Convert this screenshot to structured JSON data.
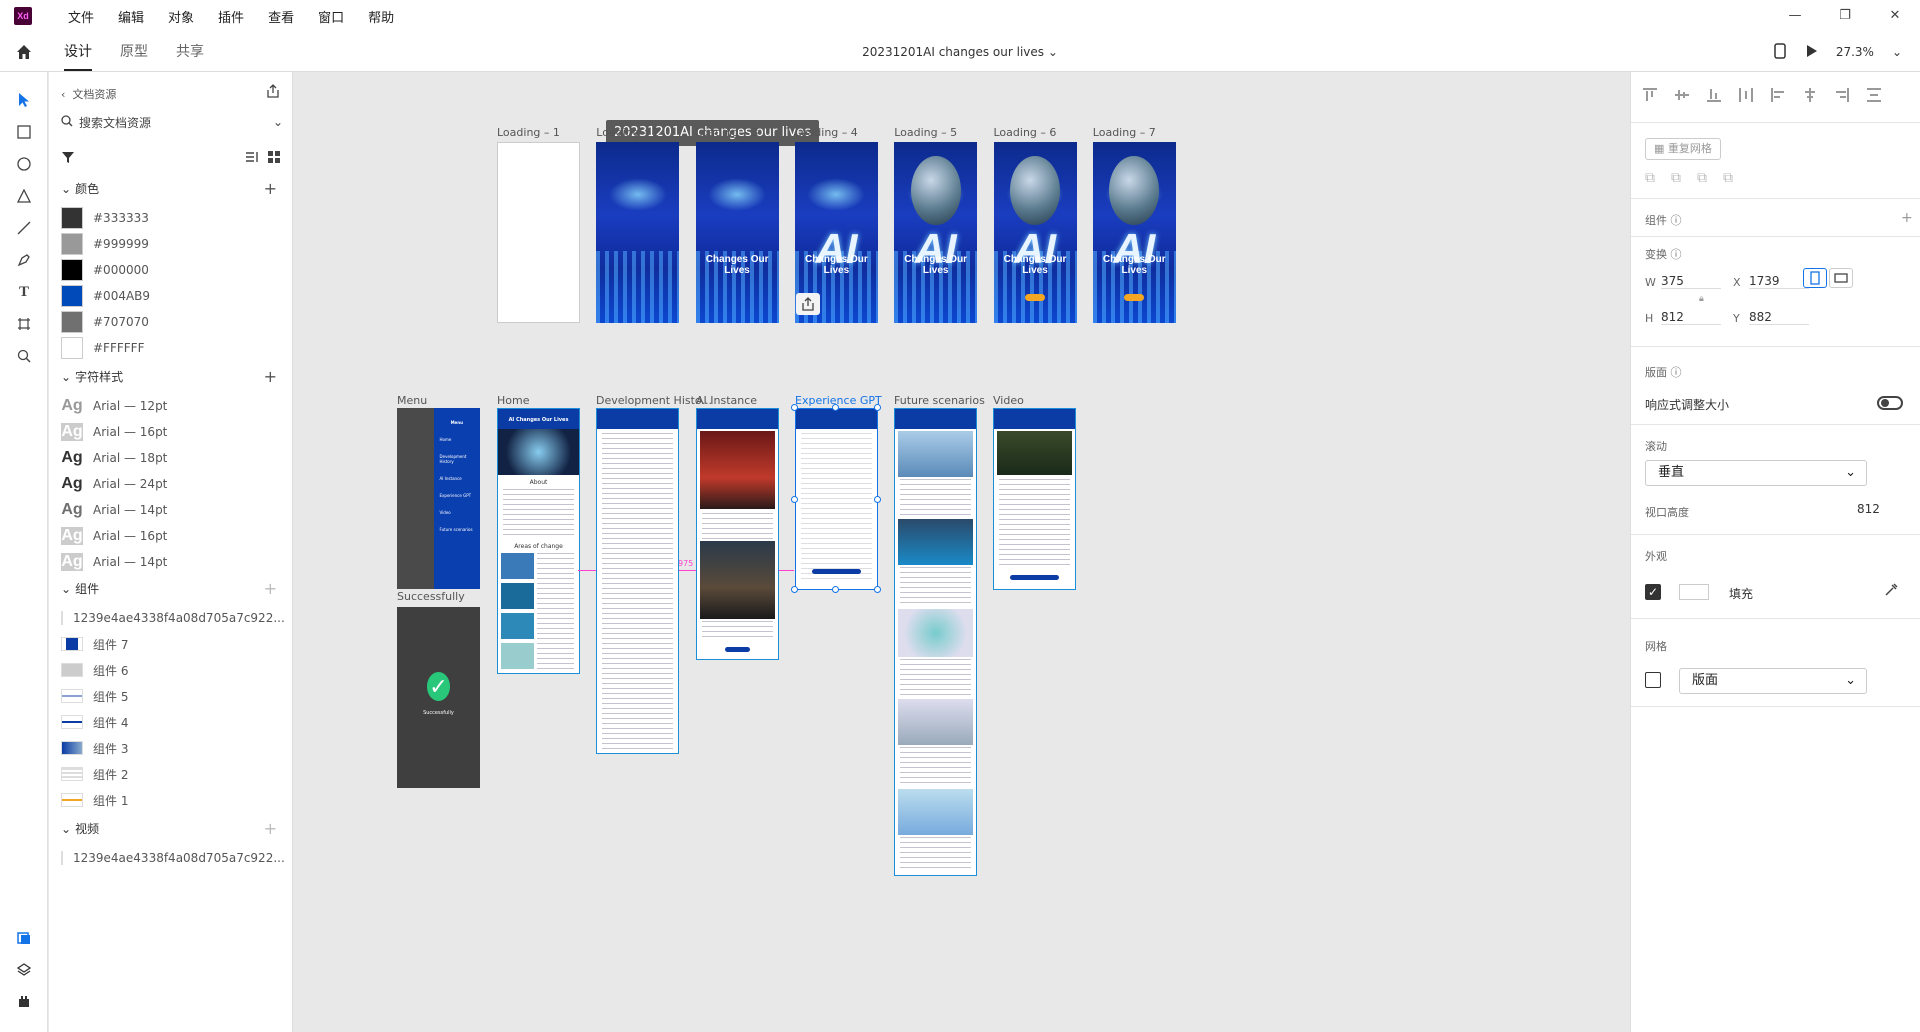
{
  "app": {
    "logo": "Xd",
    "accent": "#1473e6",
    "brand_color": "#470137"
  },
  "menu": [
    "文件",
    "编辑",
    "对象",
    "插件",
    "查看",
    "窗口",
    "帮助"
  ],
  "tabs": [
    "设计",
    "原型",
    "共享"
  ],
  "active_tab": "设计",
  "document_title": "20231201AI changes our lives",
  "zoom": "27.3%",
  "assets": {
    "header": "文档资源",
    "search_placeholder": "搜索文档资源",
    "colors_title": "颜色",
    "colors": [
      {
        "hex": "#333333",
        "label": "#333333"
      },
      {
        "hex": "#999999",
        "label": "#999999"
      },
      {
        "hex": "#000000",
        "label": "#000000"
      },
      {
        "hex": "#004AB9",
        "label": "#004AB9"
      },
      {
        "hex": "#707070",
        "label": "#707070"
      },
      {
        "hex": "#FFFFFF",
        "label": "#FFFFFF"
      }
    ],
    "char_title": "字符样式",
    "char_styles": [
      {
        "sample": "Ag",
        "label": "Arial — 12pt",
        "color": "#999999",
        "bg": "#ffffff"
      },
      {
        "sample": "Ag",
        "label": "Arial — 16pt",
        "color": "#ffffff",
        "bg": "#cccccc"
      },
      {
        "sample": "Ag",
        "label": "Arial — 18pt",
        "color": "#333333",
        "bg": "#ffffff"
      },
      {
        "sample": "Ag",
        "label": "Arial — 24pt",
        "color": "#333333",
        "bg": "#ffffff"
      },
      {
        "sample": "Ag",
        "label": "Arial — 14pt",
        "color": "#707070",
        "bg": "#ffffff"
      },
      {
        "sample": "Ag",
        "label": "Arial — 16pt",
        "color": "#ffffff",
        "bg": "#cccccc"
      },
      {
        "sample": "Ag",
        "label": "Arial — 14pt",
        "color": "#ffffff",
        "bg": "#cccccc"
      }
    ],
    "components_title": "组件",
    "components": [
      "1239e4ae4338f4a08d705a7c922...",
      "组件 7",
      "组件 6",
      "组件 5",
      "组件 4",
      "组件 3",
      "组件 2",
      "组件 1"
    ],
    "video_title": "视频",
    "videos": [
      "1239e4ae4338f4a08d705a7c922..."
    ]
  },
  "canvas": {
    "doc_chip": "20231201AI changes our lives",
    "loading_labels": [
      "Loading – 1",
      "Loading – 2",
      "Loading – 3",
      "Loading – 4",
      "Loading – 5",
      "Loading – 6",
      "Loading – 7"
    ],
    "loading_ai_text": "AI",
    "loading_subtitle": "Changes Our Lives",
    "page_labels": [
      "Menu",
      "Home",
      "Development Histo...",
      "AI Instance",
      "Experience GPT",
      "Future scenarios",
      "Video"
    ],
    "successfully_label": "Successfully",
    "success_text": "Successfully",
    "guide_value": "975",
    "home_title": "AI Changes Our Lives",
    "home_about": "About",
    "home_areas": "Areas of change",
    "menu_items": [
      "Menu",
      "Home",
      "Development History",
      "AI Instance",
      "Experience GPT",
      "Video",
      "Future scenarios"
    ]
  },
  "props": {
    "repeat_grid": "重复网格",
    "component_label": "组件",
    "transform_label": "变换",
    "w_label": "W",
    "w": "375",
    "x_label": "X",
    "x": "1739",
    "h_label": "H",
    "h": "812",
    "y_label": "Y",
    "y": "882",
    "layout_label": "版面",
    "responsive": "响应式调整大小",
    "scroll_label": "滚动",
    "scroll_value": "垂直",
    "viewport_label": "视口高度",
    "viewport_value": "812",
    "appearance_label": "外观",
    "fill_label": "填充",
    "grid_label": "网格",
    "grid_value": "版面"
  }
}
